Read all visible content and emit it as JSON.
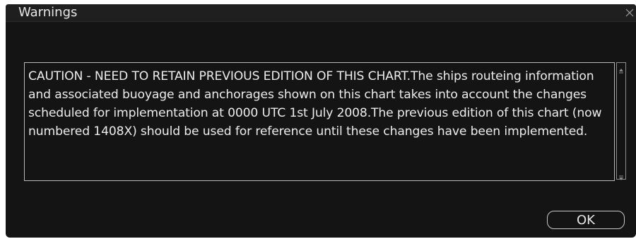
{
  "dialog": {
    "title": "Warnings",
    "close_icon": "close-icon",
    "message": "CAUTION - NEED TO RETAIN PREVIOUS EDITION OF THIS CHART.The ships routeing information and associated buoyage and anchorages shown on this chart takes into account the changes scheduled for implementation at 0000 UTC 1st July 2008.The previous edition of this chart (now numbered 1408X) should be used for reference until these changes have been implemented.",
    "scrollbar": {
      "up_icon": "scroll-up-arrow-icon",
      "down_icon": "scroll-down-arrow-icon"
    },
    "ok_label": "OK"
  },
  "colors": {
    "background": "#141414",
    "titlebar": "#1f1f1f",
    "text": "#ececec",
    "border": "#b9b9b9"
  }
}
